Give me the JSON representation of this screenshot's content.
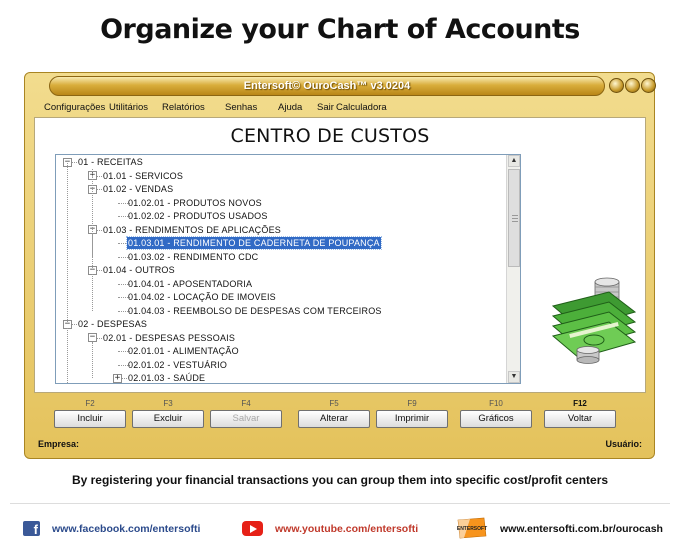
{
  "page": {
    "headline": "Organize your Chart of Accounts",
    "caption": "By registering your financial transactions you can group them into specific cost/profit centers"
  },
  "window": {
    "title": "Entersoft© OuroCash™ v3.0204",
    "menu": [
      {
        "label": "Configurações"
      },
      {
        "label": "Utilitários"
      },
      {
        "label": "Relatórios"
      },
      {
        "label": "Senhas"
      },
      {
        "label": "Ajuda"
      },
      {
        "label": "Sair"
      },
      {
        "label": "Calculadora"
      }
    ],
    "panel_title": "CENTRO DE CUSTOS"
  },
  "tree": {
    "items": [
      {
        "label": "01 - RECEITAS",
        "level": 0,
        "expander": "−"
      },
      {
        "label": "01.01 - SERVICOS",
        "level": 1,
        "expander": "+"
      },
      {
        "label": "01.02 - VENDAS",
        "level": 1,
        "expander": "−"
      },
      {
        "label": "01.02.01 - PRODUTOS NOVOS",
        "level": 2,
        "expander": ""
      },
      {
        "label": "01.02.02 - PRODUTOS USADOS",
        "level": 2,
        "expander": ""
      },
      {
        "label": "01.03 - RENDIMENTOS DE APLICAÇÕES",
        "level": 1,
        "expander": "−"
      },
      {
        "label": "01.03.01 - RENDIMENTO DE CADERNETA DE POUPANÇA",
        "level": 2,
        "expander": "",
        "selected": true
      },
      {
        "label": "01.03.02 - RENDIMENTO CDC",
        "level": 2,
        "expander": ""
      },
      {
        "label": "01.04 - OUTROS",
        "level": 1,
        "expander": "−"
      },
      {
        "label": "01.04.01 - APOSENTADORIA",
        "level": 2,
        "expander": ""
      },
      {
        "label": "01.04.02 - LOCAÇÃO DE IMOVEIS",
        "level": 2,
        "expander": ""
      },
      {
        "label": "01.04.03 - REEMBOLSO DE DESPESAS COM TERCEIROS",
        "level": 2,
        "expander": ""
      },
      {
        "label": "02 - DESPESAS",
        "level": 0,
        "expander": "−"
      },
      {
        "label": "02.01 - DESPESAS PESSOAIS",
        "level": 1,
        "expander": "−"
      },
      {
        "label": "02.01.01 - ALIMENTAÇÃO",
        "level": 2,
        "expander": ""
      },
      {
        "label": "02.01.02 - VESTUÁRIO",
        "level": 2,
        "expander": ""
      },
      {
        "label": "02.01.03 - SAÚDE",
        "level": 2,
        "expander": "+"
      }
    ]
  },
  "toolbar": {
    "buttons": [
      {
        "key": "F2",
        "label": "Incluir",
        "enabled": true
      },
      {
        "key": "F3",
        "label": "Excluir",
        "enabled": true
      },
      {
        "key": "F4",
        "label": "Salvar",
        "enabled": false
      },
      {
        "key": "F5",
        "label": "Alterar",
        "enabled": true
      },
      {
        "key": "F9",
        "label": "Imprimir",
        "enabled": true
      },
      {
        "key": "F10",
        "label": "Gráficos",
        "enabled": true
      },
      {
        "key": "F12",
        "label": "Voltar",
        "enabled": true
      }
    ]
  },
  "status": {
    "empresa_label": "Empresa:",
    "usuario_label": "Usuário:"
  },
  "footer": {
    "facebook": "www.facebook.com/entersofti",
    "youtube": "www.youtube.com/entersofti",
    "website": "www.entersofti.com.br/ourocash",
    "logo_text": "ENTERSOFT"
  },
  "colors": {
    "frame_gold": "#e4c25c",
    "selection_blue": "#316ac5",
    "facebook_blue": "#3b5998",
    "youtube_red": "#e62117",
    "money_green": "#4caf3a"
  }
}
